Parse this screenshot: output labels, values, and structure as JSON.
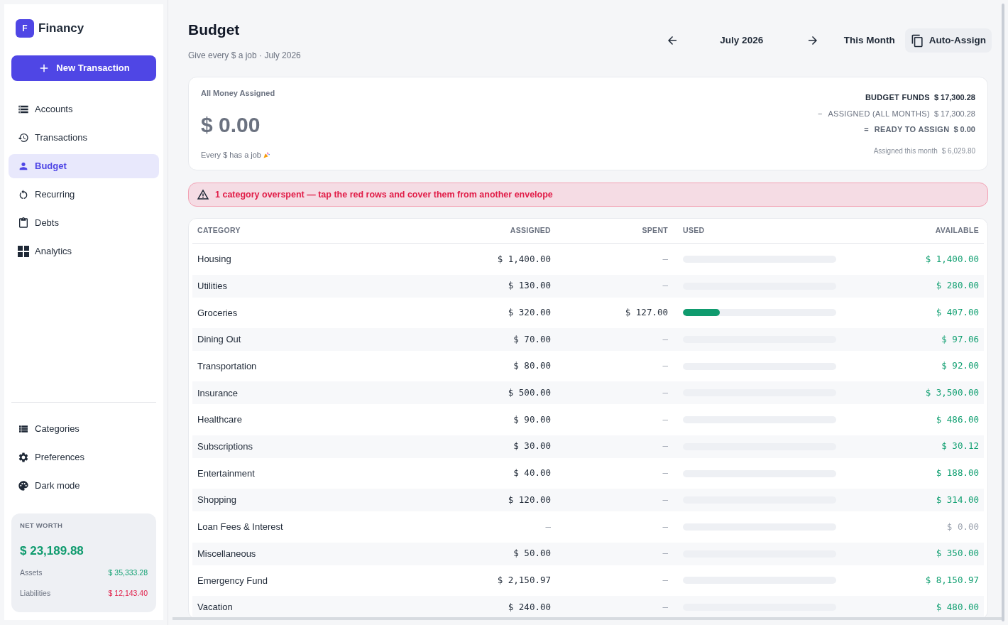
{
  "sidebar": {
    "logo": {
      "letter": "F",
      "name": "Financy"
    },
    "new_button": {
      "label": "New Transaction"
    },
    "nav": [
      {
        "label": "Accounts",
        "selected": false
      },
      {
        "label": "Transactions",
        "selected": false
      },
      {
        "label": "Budget",
        "selected": true
      },
      {
        "label": "Recurring",
        "selected": false
      },
      {
        "label": "Debts",
        "selected": false
      },
      {
        "label": "Analytics",
        "selected": false
      }
    ],
    "bottom_nav": [
      {
        "label": "Categories",
        "selected": false
      },
      {
        "label": "Preferences",
        "selected": false
      },
      {
        "label": "Dark mode",
        "selected": false
      }
    ],
    "net_worth": {
      "title": "NET WORTH",
      "value": "$ 23,189.88",
      "rows": [
        {
          "label": "Assets",
          "value": "$ 35,333.28",
          "color": "#12a072"
        },
        {
          "label": "Liabilities",
          "value": "$ 12,143.40",
          "color": "#e11d48"
        }
      ]
    }
  },
  "header": {
    "title": "Budget",
    "subtitle": "Give every $ a job · July 2026",
    "month": "July 2026",
    "this_month": "This Month",
    "auto_assign": "Auto-Assign"
  },
  "summary": {
    "title": "All Money Assigned",
    "amount": "$ 0.00",
    "note": "Every $ has a job",
    "lines": [
      {
        "kind": "total",
        "label": "BUDGET FUNDS",
        "value": "$ 17,300.28"
      },
      {
        "kind": "minus",
        "sign": "−",
        "label": "ASSIGNED (ALL MONTHS)",
        "value": "$ 17,300.28"
      },
      {
        "kind": "result",
        "sign": "=",
        "label": "READY TO ASSIGN",
        "value": "$ 0.00"
      }
    ],
    "month_assigned": {
      "label": "Assigned this month",
      "value": "$ 6,029.80"
    }
  },
  "alert": {
    "text": "1 category overspent — tap the red rows and cover them from another envelope"
  },
  "table": {
    "columns": [
      "CATEGORY",
      "ASSIGNED",
      "SPENT",
      "USED",
      "AVAILABLE"
    ],
    "rows": [
      {
        "category": "Housing",
        "assigned": {
          "text": "$ 1,400.00",
          "muted": false
        },
        "spent": {
          "text": "–",
          "muted": true
        },
        "available": "$ 1,400.00",
        "color": "#12a072"
      },
      {
        "category": "Utilities",
        "assigned": {
          "text": "$ 130.00",
          "muted": false
        },
        "spent": {
          "text": "–",
          "muted": true
        },
        "available": "$ 280.00",
        "color": "#12a072"
      },
      {
        "category": "Groceries",
        "assigned": {
          "text": "$ 320.00",
          "muted": false
        },
        "spent": {
          "text": "$ 127.00",
          "muted": false
        },
        "level": 0.24,
        "available": "$ 407.00",
        "color": "#12a072"
      },
      {
        "category": "Dining Out",
        "assigned": {
          "text": "$ 70.00",
          "muted": false
        },
        "spent": {
          "text": "–",
          "muted": true
        },
        "available": "$ 97.06",
        "color": "#12a072"
      },
      {
        "category": "Transportation",
        "assigned": {
          "text": "$ 80.00",
          "muted": false
        },
        "spent": {
          "text": "–",
          "muted": true
        },
        "available": "$ 92.00",
        "color": "#12a072"
      },
      {
        "category": "Insurance",
        "assigned": {
          "text": "$ 500.00",
          "muted": false
        },
        "spent": {
          "text": "–",
          "muted": true
        },
        "available": "$ 3,500.00",
        "color": "#12a072"
      },
      {
        "category": "Healthcare",
        "assigned": {
          "text": "$ 90.00",
          "muted": false
        },
        "spent": {
          "text": "–",
          "muted": true
        },
        "available": "$ 486.00",
        "color": "#12a072"
      },
      {
        "category": "Subscriptions",
        "assigned": {
          "text": "$ 30.00",
          "muted": false
        },
        "spent": {
          "text": "–",
          "muted": true
        },
        "available": "$ 30.12",
        "color": "#12a072"
      },
      {
        "category": "Entertainment",
        "assigned": {
          "text": "$ 40.00",
          "muted": false
        },
        "spent": {
          "text": "–",
          "muted": true
        },
        "available": "$ 188.00",
        "color": "#12a072"
      },
      {
        "category": "Shopping",
        "assigned": {
          "text": "$ 120.00",
          "muted": false
        },
        "spent": {
          "text": "–",
          "muted": true
        },
        "available": "$ 314.00",
        "color": "#12a072"
      },
      {
        "category": "Loan Fees & Interest",
        "assigned": {
          "text": "–",
          "muted": true
        },
        "spent": {
          "text": "–",
          "muted": true
        },
        "available": "$ 0.00",
        "color": "#9ca3af"
      },
      {
        "category": "Miscellaneous",
        "assigned": {
          "text": "$ 50.00",
          "muted": false
        },
        "spent": {
          "text": "–",
          "muted": true
        },
        "available": "$ 350.00",
        "color": "#12a072"
      },
      {
        "category": "Emergency Fund",
        "assigned": {
          "text": "$ 2,150.97",
          "muted": false
        },
        "spent": {
          "text": "–",
          "muted": true
        },
        "available": "$ 8,150.97",
        "color": "#12a072"
      },
      {
        "category": "Vacation",
        "assigned": {
          "text": "$ 240.00",
          "muted": false
        },
        "spent": {
          "text": "–",
          "muted": true
        },
        "available": "$ 480.00",
        "color": "#12a072"
      }
    ]
  }
}
